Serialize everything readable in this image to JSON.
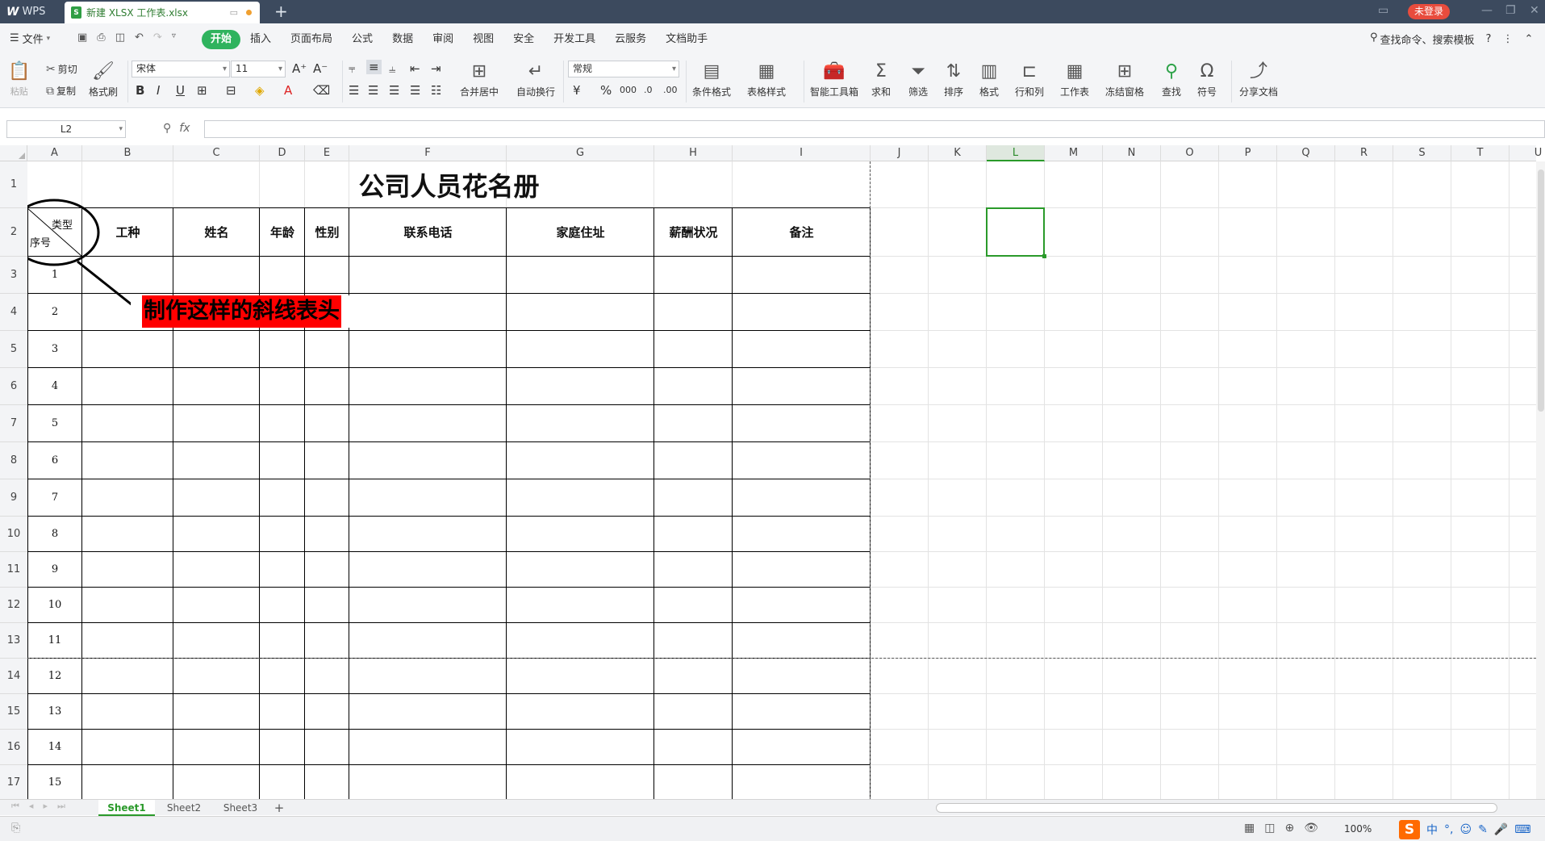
{
  "titlebar": {
    "app_tab": "WPS",
    "doc_tab": "新建 XLSX 工作表.xlsx",
    "login": "未登录"
  },
  "menubar": {
    "file": "文件",
    "items": [
      "开始",
      "插入",
      "页面布局",
      "公式",
      "数据",
      "审阅",
      "视图",
      "安全",
      "开发工具",
      "云服务",
      "文档助手"
    ],
    "active": "开始",
    "search": "查找命令、搜索模板"
  },
  "ribbon": {
    "paste": "粘贴",
    "cut": "剪切",
    "copy": "复制",
    "format_painter": "格式刷",
    "font_name": "宋体",
    "font_size": "11",
    "merge_center": "合并居中",
    "wrap_text": "自动换行",
    "number_format": "常规",
    "conditional_format": "条件格式",
    "table_style": "表格样式",
    "smart_toolbox": "智能工具箱",
    "sum": "求和",
    "filter": "筛选",
    "sort": "排序",
    "format": "格式",
    "row_col": "行和列",
    "worksheet": "工作表",
    "freeze": "冻结窗格",
    "find": "查找",
    "symbol": "符号",
    "share": "分享文档"
  },
  "formula_bar": {
    "name_box": "L2",
    "fx": "fx",
    "value": ""
  },
  "grid": {
    "columns": [
      "A",
      "B",
      "C",
      "D",
      "E",
      "F",
      "G",
      "H",
      "I",
      "J",
      "K",
      "L",
      "M",
      "N",
      "O",
      "P",
      "Q",
      "R",
      "S",
      "T",
      "U"
    ],
    "active_column": "L",
    "rows": [
      "1",
      "2",
      "3",
      "4",
      "5",
      "6",
      "7",
      "8",
      "9",
      "10",
      "11",
      "12",
      "13",
      "14",
      "15",
      "16",
      "17"
    ],
    "active_cell": "L2"
  },
  "table": {
    "title": "公司人员花名册",
    "diag_top": "类型",
    "diag_bottom": "序号",
    "headers": [
      "工种",
      "姓名",
      "年龄",
      "性别",
      "联系电话",
      "家庭住址",
      "薪酬状况",
      "备注"
    ],
    "serials": [
      "1",
      "2",
      "3",
      "4",
      "5",
      "6",
      "7",
      "8",
      "9",
      "10",
      "11",
      "12",
      "13",
      "14",
      "15"
    ]
  },
  "callout": "制作这样的斜线表头",
  "sheets": {
    "tabs": [
      "Sheet1",
      "Sheet2",
      "Sheet3"
    ],
    "active": "Sheet1"
  },
  "status": {
    "zoom": "100%",
    "ime": "中"
  },
  "colors": {
    "accent_green": "#2fb35e",
    "titlebar": "#3c4a5e",
    "callout_bg": "#ff0000",
    "login_red": "#e84c3d"
  }
}
